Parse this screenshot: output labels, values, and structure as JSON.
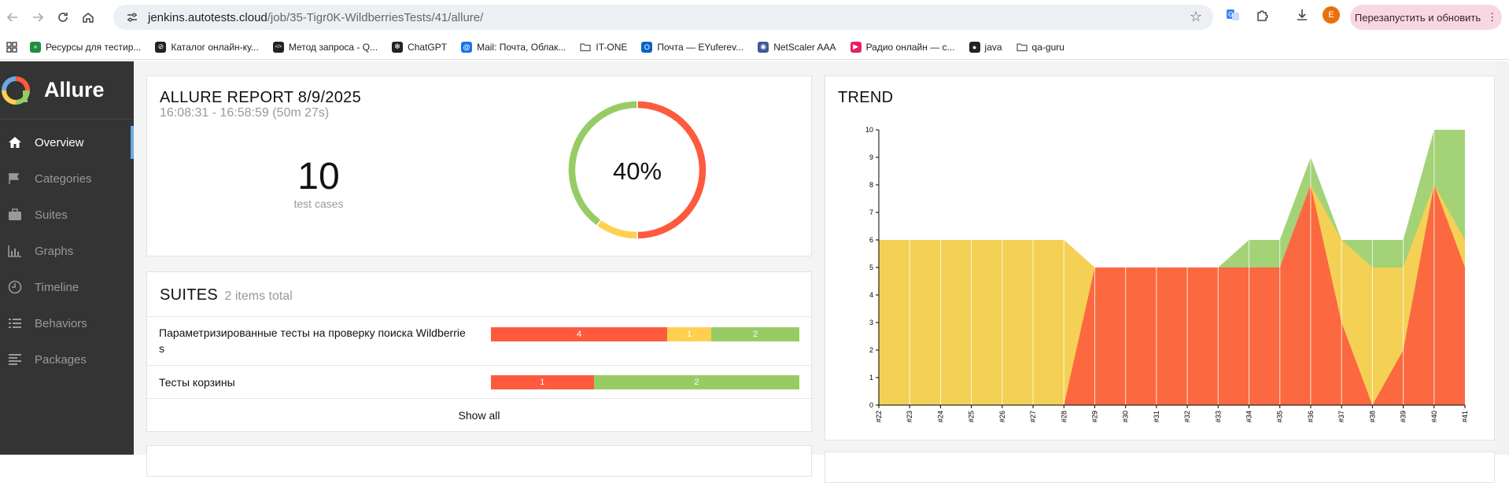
{
  "browser": {
    "url_host": "jenkins.autotests.cloud",
    "url_path": "/job/35-Tigr0K-WildberriesTests/41/allure/",
    "profile_initial": "E",
    "restart_label": "Перезапустить и обновить"
  },
  "bookmarks": [
    {
      "label": "Ресурсы для тестир...",
      "icon": "plus-square-icon",
      "color": "#1e8e3e"
    },
    {
      "label": "Каталог онлайн-ку...",
      "icon": "circle-slash-icon",
      "color": "#222"
    },
    {
      "label": "Метод запроса - Q...",
      "icon": "code-icon",
      "color": "#222"
    },
    {
      "label": "ChatGPT",
      "icon": "chatgpt-icon",
      "color": "#222"
    },
    {
      "label": "Mail: Почта, Облак...",
      "icon": "at-icon",
      "color": "#1a73e8"
    },
    {
      "label": "IT-ONE",
      "icon": "folder-icon",
      "color": "#555"
    },
    {
      "label": "Почта — EYuferev...",
      "icon": "outlook-icon",
      "color": "#0a64c8"
    },
    {
      "label": "NetScaler AAA",
      "icon": "robot-icon",
      "color": "#3b5998"
    },
    {
      "label": "Радио онлайн — с...",
      "icon": "play-icon",
      "color": "#e91e63"
    },
    {
      "label": "java",
      "icon": "github-icon",
      "color": "#222"
    },
    {
      "label": "qa-guru",
      "icon": "folder-icon",
      "color": "#555"
    }
  ],
  "sidebar": {
    "brand": "Allure",
    "items": [
      {
        "label": "Overview",
        "icon": "home-icon",
        "active": true
      },
      {
        "label": "Categories",
        "icon": "flag-icon",
        "active": false
      },
      {
        "label": "Suites",
        "icon": "briefcase-icon",
        "active": false
      },
      {
        "label": "Graphs",
        "icon": "bar-chart-icon",
        "active": false
      },
      {
        "label": "Timeline",
        "icon": "clock-icon",
        "active": false
      },
      {
        "label": "Behaviors",
        "icon": "list-icon",
        "active": false
      },
      {
        "label": "Packages",
        "icon": "align-left-icon",
        "active": false
      }
    ]
  },
  "summary": {
    "title": "ALLURE REPORT 8/9/2025",
    "time_range": "16:08:31 - 16:58:59 (50m 27s)",
    "test_count": "10",
    "test_count_label": "test cases",
    "success_rate": "40%",
    "donut": {
      "failed": 5,
      "broken": 1,
      "passed": 4
    }
  },
  "suites": {
    "title": "SUITES",
    "subtitle": "2 items total",
    "rows": [
      {
        "name": "Параметризированные тесты на проверку поиска Wildberrie s",
        "failed": 4,
        "broken": 1,
        "passed": 2,
        "failed_label": "4",
        "broken_label": "1",
        "passed_label": "2"
      },
      {
        "name": "Тесты корзины",
        "failed": 1,
        "broken": 0,
        "passed": 2,
        "failed_label": "1",
        "broken_label": "",
        "passed_label": "2"
      }
    ],
    "show_all": "Show all"
  },
  "colors": {
    "failed": "#fd5a3e",
    "broken": "#ffd050",
    "passed": "#97cc64",
    "trend_failed": "#fd5a3e",
    "trend_broken": "#ffd050",
    "trend_passed": "#97cc64"
  },
  "trend": {
    "title": "TREND",
    "chart_data": {
      "type": "area",
      "x": [
        "#22",
        "#23",
        "#24",
        "#25",
        "#26",
        "#27",
        "#28",
        "#29",
        "#30",
        "#31",
        "#32",
        "#33",
        "#34",
        "#35",
        "#36",
        "#37",
        "#38",
        "#39",
        "#40",
        "#41"
      ],
      "series": [
        {
          "name": "failed",
          "values": [
            0,
            0,
            0,
            0,
            0,
            0,
            0,
            5,
            5,
            5,
            5,
            5,
            5,
            5,
            8,
            3,
            0,
            2,
            8,
            5
          ]
        },
        {
          "name": "broken",
          "values": [
            6,
            6,
            6,
            6,
            6,
            6,
            6,
            0,
            0,
            0,
            0,
            0,
            0,
            0,
            0,
            3,
            5,
            3,
            0,
            1
          ]
        },
        {
          "name": "passed",
          "values": [
            0,
            0,
            0,
            0,
            0,
            0,
            0,
            0,
            0,
            0,
            0,
            0,
            1,
            1,
            1,
            0,
            1,
            1,
            2,
            4
          ]
        }
      ],
      "yticks": [
        "0",
        "1",
        "2",
        "3",
        "4",
        "5",
        "6",
        "7",
        "8",
        "9",
        "10"
      ],
      "ylim": [
        0,
        10
      ]
    }
  }
}
